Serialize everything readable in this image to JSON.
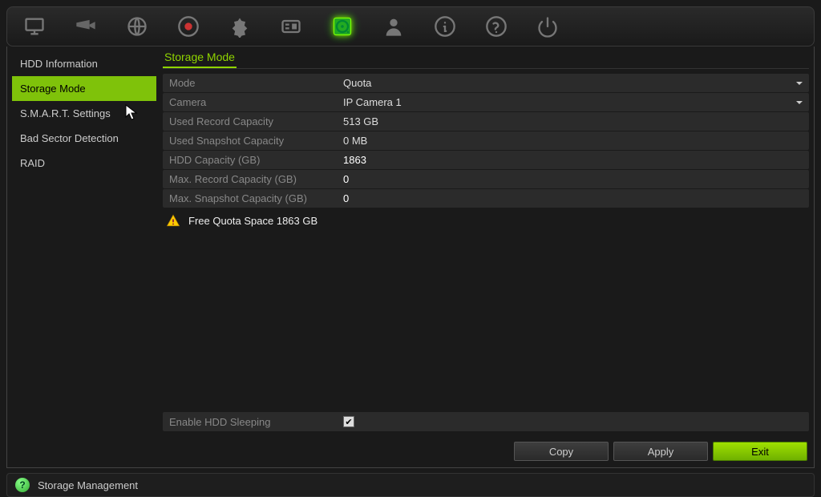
{
  "toolbar": {
    "icons": [
      "monitor-icon",
      "camera-icon",
      "globe-icon",
      "record-icon",
      "alert-icon",
      "settings-icon",
      "hdd-icon",
      "user-icon",
      "info-icon",
      "help-icon",
      "power-icon"
    ],
    "active_index": 6
  },
  "sidebar": {
    "items": [
      {
        "label": "HDD Information"
      },
      {
        "label": "Storage Mode"
      },
      {
        "label": "S.M.A.R.T. Settings"
      },
      {
        "label": "Bad Sector Detection"
      },
      {
        "label": "RAID"
      }
    ],
    "active_index": 1
  },
  "main": {
    "tab_title": "Storage Mode",
    "rows": {
      "mode_label": "Mode",
      "mode_value": "Quota",
      "camera_label": "Camera",
      "camera_value": "IP Camera 1",
      "used_record_label": "Used Record Capacity",
      "used_record_value": "513 GB",
      "used_snapshot_label": "Used Snapshot Capacity",
      "used_snapshot_value": "0 MB",
      "hdd_cap_label": "HDD Capacity (GB)",
      "hdd_cap_value": "1863",
      "max_rec_label": "Max. Record Capacity (GB)",
      "max_rec_value": "0",
      "max_snap_label": "Max. Snapshot Capacity (GB)",
      "max_snap_value": "0"
    },
    "warning_text": "Free Quota Space 1863 GB",
    "sleep_label": "Enable HDD Sleeping",
    "sleep_checked": true,
    "buttons": {
      "copy": "Copy",
      "apply": "Apply",
      "exit": "Exit"
    }
  },
  "statusbar": {
    "label": "Storage Management"
  }
}
